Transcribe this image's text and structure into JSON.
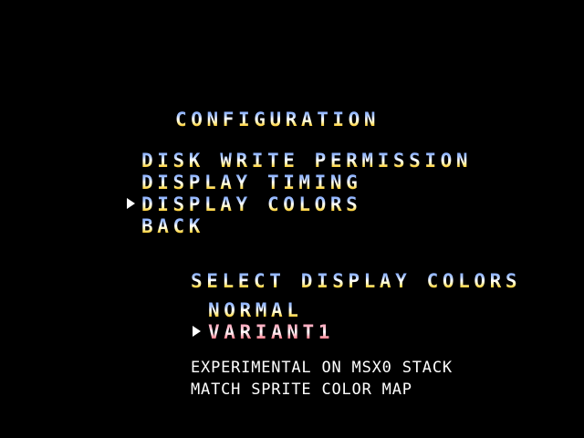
{
  "menu": {
    "title": "CONFIGURATION",
    "items": [
      {
        "label": "DISK WRITE PERMISSION"
      },
      {
        "label": "DISPLAY TIMING"
      },
      {
        "label": "DISPLAY COLORS"
      },
      {
        "label": "BACK"
      }
    ],
    "selected_index": 2
  },
  "submenu": {
    "title": "SELECT DISPLAY COLORS",
    "options": [
      {
        "label": "NORMAL"
      },
      {
        "label": "VARIANT1"
      }
    ],
    "selected_index": 1,
    "description": [
      "EXPERIMENTAL ON MSX0 STACK",
      "MATCH SPRITE COLOR MAP"
    ]
  },
  "colors": {
    "background": "#000000",
    "gradient_top": "#7fa8ff",
    "gradient_bottom": "#ffd23a",
    "selected_option_accent": "#ff6a7a",
    "cursor": "#ffffff"
  },
  "icons": {
    "cursor": "right-triangle-icon"
  }
}
